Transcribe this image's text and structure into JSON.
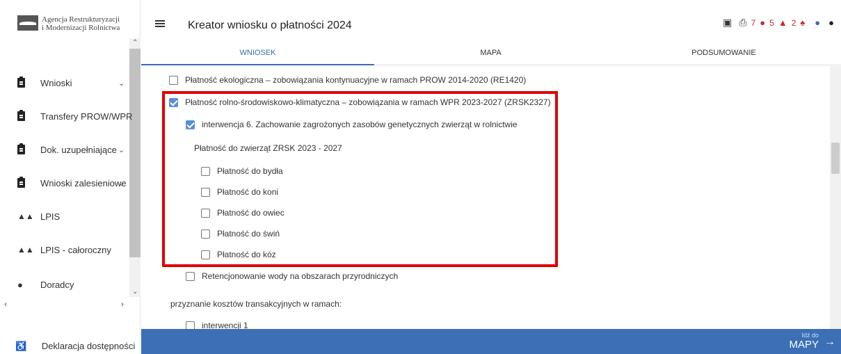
{
  "agency": {
    "line1": "Agencja Restrukturyzacji",
    "line2": "i Modernizacji Rolnictwa"
  },
  "sidebar": {
    "items": [
      {
        "label": "Wnioski",
        "icon": "clipboard-icon",
        "chevron": "⌄"
      },
      {
        "label": "Transfery PROW/WPR",
        "icon": "clipboard-icon",
        "chevron": ""
      },
      {
        "label": "Dok. uzupełniające",
        "icon": "clipboard-icon",
        "chevron": "⌄"
      },
      {
        "label": "Wnioski zalesieniowe",
        "icon": "clipboard-icon",
        "chevron": "⌄"
      },
      {
        "label": "LPIS",
        "icon": "terrain-icon",
        "chevron": ""
      },
      {
        "label": "LPIS - całoroczny",
        "icon": "terrain-icon",
        "chevron": ""
      },
      {
        "label": "Doradcy",
        "icon": "person-icon",
        "chevron": ""
      }
    ],
    "accessibility": "Deklaracja dostępności"
  },
  "header": {
    "title": "Kreator wniosku o płatności 2024",
    "error_count": "7",
    "warning_count": "5",
    "notification_count": "2"
  },
  "tabs": [
    "WNIOSEK",
    "MAPA",
    "PODSUMOWANIE"
  ],
  "content": {
    "eco_payment": "Płatność ekologiczna – zobowiązania kontynuacyjne w ramach PROW 2014-2020 (RE1420)",
    "agri_env": "Płatność rolno-środowiskowo-klimatyczna – zobowiązania w ramach WPR 2023-2027 (ZRSK2327)",
    "intervention6": "interwencja 6. Zachowanie zagrożonych zasobów genetycznych zwierząt w rolnictwie",
    "animal_payment_heading": "Płatność do zwierząt ZRSK 2023 - 2027",
    "animals": [
      "Płatność do bydła",
      "Płatność do koni",
      "Płatność do owiec",
      "Płatność do świń",
      "Płatność do kóz"
    ],
    "water_retention": "Retencjonowanie wody na obszarach przyrodniczych",
    "transaction_costs": "przyznanie kosztów transakcyjnych w ramach:",
    "intervention1": "interwencji 1"
  },
  "footer": {
    "goto_small": "Idź do",
    "goto_big": "MAPY"
  }
}
